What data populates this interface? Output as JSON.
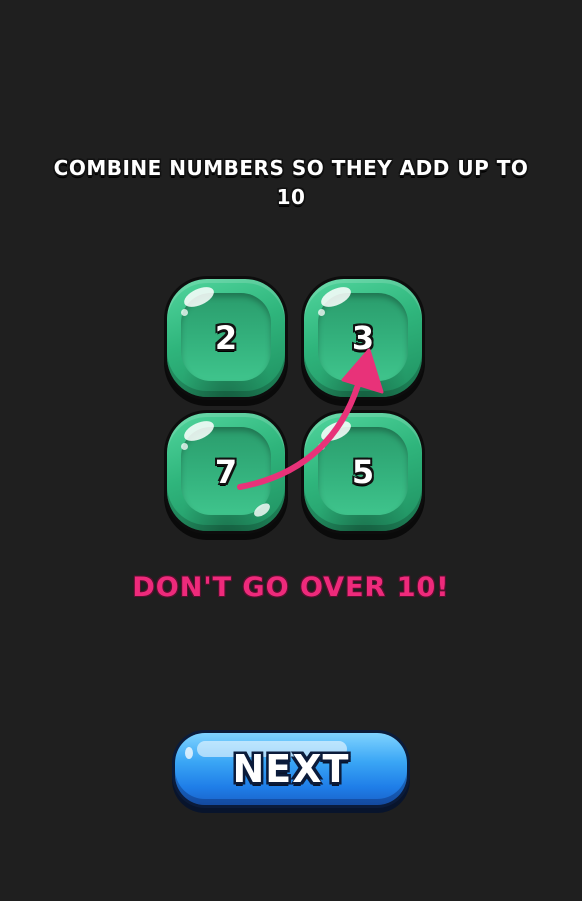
{
  "tutorial": {
    "instruction": "COMBINE NUMBERS SO THEY ADD UP TO 10",
    "warning": "DON'T GO OVER 10!",
    "next_label": "NEXT"
  },
  "tiles": [
    {
      "number": "2"
    },
    {
      "number": "3"
    },
    {
      "number": "7"
    },
    {
      "number": "5"
    }
  ],
  "arrow": {
    "from": "7",
    "to": "3",
    "icon": "curved-arrow-icon"
  },
  "colors": {
    "background": "#1f1f1f",
    "tile_green": "#2fb57c",
    "warning_pink": "#ee2a7b",
    "arrow_pink": "#e83279",
    "button_blue": "#1f7ee8"
  }
}
